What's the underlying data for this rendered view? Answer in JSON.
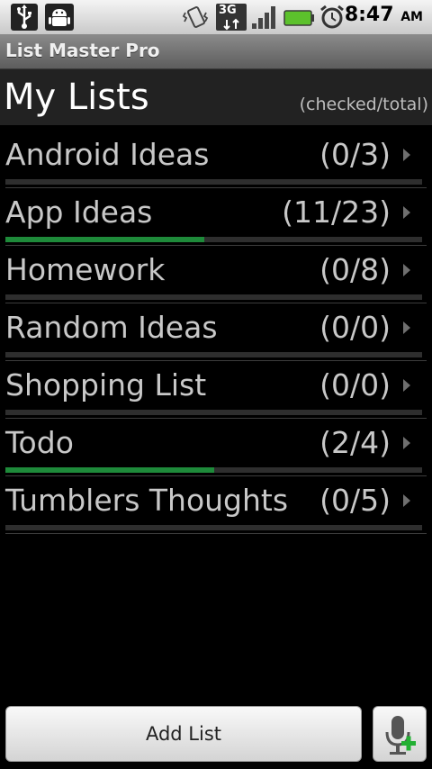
{
  "status_bar": {
    "time": "8:47",
    "ampm": "AM",
    "network": "3G",
    "icons": [
      "usb-icon",
      "android-debug-icon",
      "vibrate-icon",
      "3g-data-icon",
      "signal-icon",
      "battery-icon",
      "alarm-icon"
    ]
  },
  "app": {
    "title": "List Master Pro"
  },
  "header": {
    "title": "My Lists",
    "subtitle": "(checked/total)"
  },
  "lists": [
    {
      "name": "Android Ideas",
      "count": "(0/3)",
      "progress": 0
    },
    {
      "name": "App Ideas",
      "count": "(11/23)",
      "progress": 0.4783
    },
    {
      "name": "Homework",
      "count": "(0/8)",
      "progress": 0
    },
    {
      "name": "Random Ideas",
      "count": "(0/0)",
      "progress": 0
    },
    {
      "name": "Shopping List",
      "count": "(0/0)",
      "progress": 0
    },
    {
      "name": "Todo",
      "count": "(2/4)",
      "progress": 0.5
    },
    {
      "name": "Tumblers Thoughts",
      "count": "(0/5)",
      "progress": 0
    }
  ],
  "footer": {
    "add_label": "Add List",
    "mic_icon": "microphone-add-icon"
  },
  "colors": {
    "progress": "#1e8a3a",
    "track": "#2e2e2e",
    "text": "#c8c8c8"
  }
}
